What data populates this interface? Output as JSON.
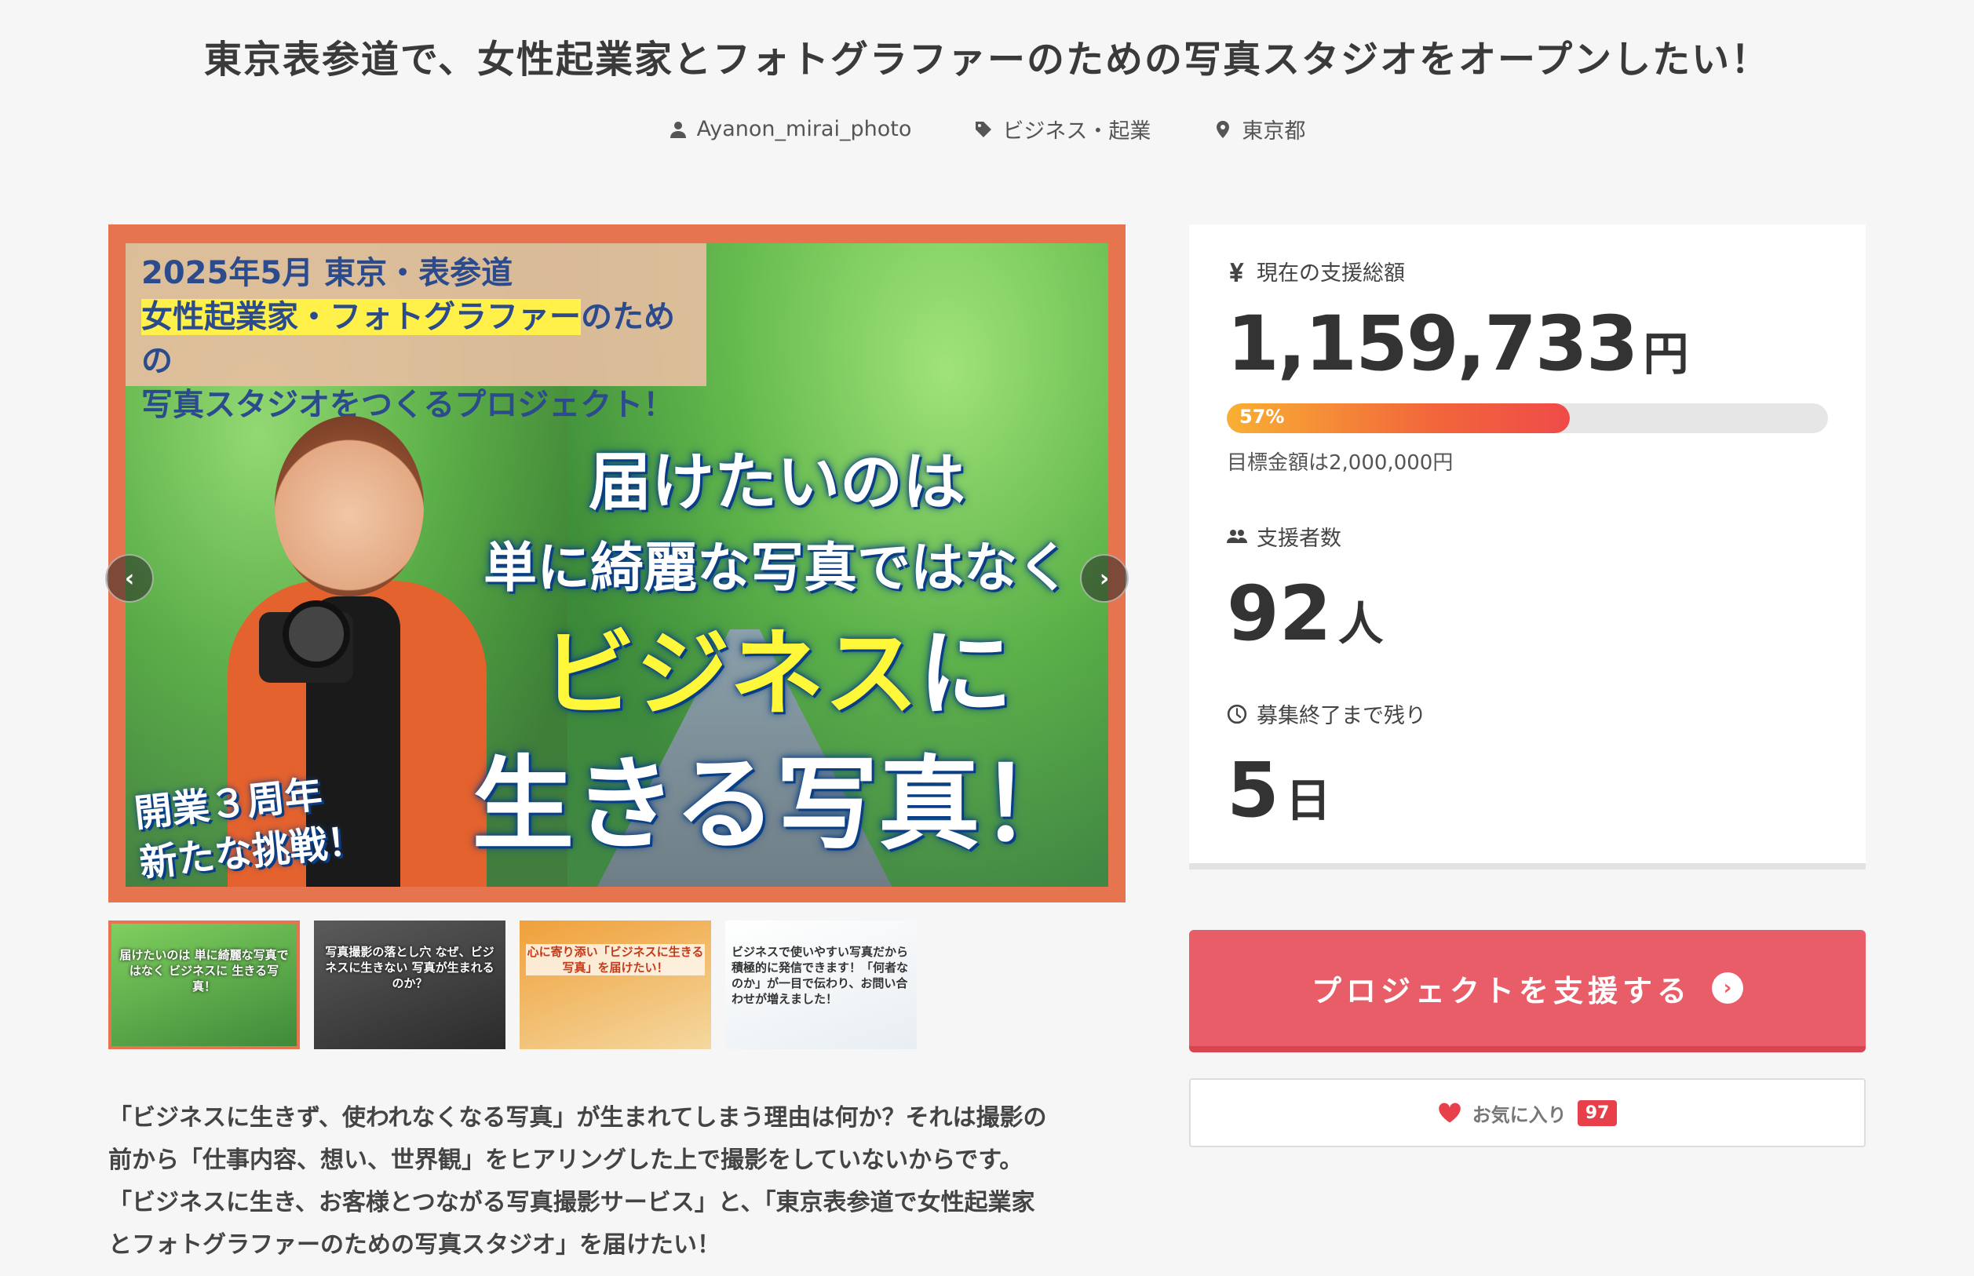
{
  "project": {
    "title": "東京表参道で、女性起業家とフォトグラファーのための写真スタジオをオープンしたい！",
    "author": "Ayanon_mirai_photo",
    "category": "ビジネス・起業",
    "location": "東京都"
  },
  "hero": {
    "banner_line1": "2025年5月 東京・表参道",
    "banner_line2": "女性起業家・フォトグラファー",
    "banner_line2b": "のための",
    "banner_line3": "写真スタジオをつくるプロジェクト！",
    "text_line1": "届けたいのは",
    "text_line2": "単に綺麗な写真ではなく",
    "text_line3a": "ビジネス",
    "text_line3b": "に",
    "text_line4": "生きる写真！",
    "anniv_line1": "開業３周年",
    "anniv_line2": "新たな挑戦！",
    "prev_label": "‹",
    "next_label": "›"
  },
  "thumbnails": [
    {
      "caption": "届けたいのは 単に綺麗な写真ではなく ビジネスに 生きる写真！",
      "active": true
    },
    {
      "caption": "写真撮影の落とし穴 なぜ、ビジネスに生きない 写真が生まれるのか？",
      "active": false
    },
    {
      "caption": "心に寄り添い「ビジネスに生きる写真」を届けたい！",
      "active": false
    },
    {
      "caption": "ビジネスで使いやすい写真だから 積極的に発信できます！「何者なのか」が一目で伝わり、お問い合わせが増えました！",
      "active": false
    }
  ],
  "description": {
    "line1": "「ビジネスに生きず、使われなくなる写真」が生まれてしまう理由は何か？それは撮影の",
    "line2": "前から「仕事内容、想い、世界観」をヒアリングした上で撮影をしていないからです。",
    "line3": "「ビジネスに生き、お客様とつながる写真撮影サービス」と、「東京表参道で女性起業家",
    "line4": "とフォトグラファーのための写真スタジオ」を届けたい！"
  },
  "stats": {
    "amount_label": "現在の支援総額",
    "amount": "1,159,733",
    "amount_unit": "円",
    "progress": 0.57,
    "progress_text": "57%",
    "goal": "目標金額は2,000,000円",
    "supporters_label": "支援者数",
    "supporters": "92",
    "supporters_unit": "人",
    "remaining_label": "募集終了まで残り",
    "remaining": "5",
    "remaining_unit": "日"
  },
  "actions": {
    "support_label": "プロジェクトを支援する",
    "support_arrow": "›",
    "favorite_label": "お気に入り",
    "favorite_count": "97"
  },
  "colors": {
    "accent": "#e85d67",
    "hero_frame": "#e5744f",
    "progress_start": "#f8b033",
    "progress_end": "#ef4b49"
  }
}
